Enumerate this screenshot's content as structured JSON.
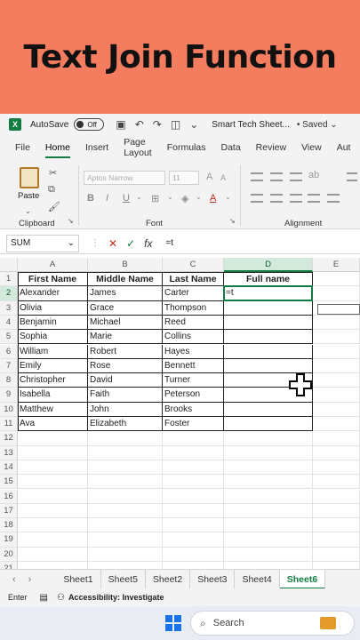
{
  "banner": {
    "title": "Text Join Function"
  },
  "titlebar": {
    "autosave_label": "AutoSave",
    "toggle_label": "Off",
    "doc_name": "Smart Tech Sheet...",
    "saved_label": "• Saved ⌄"
  },
  "menu": {
    "items": [
      "File",
      "Home",
      "Insert",
      "Page Layout",
      "Formulas",
      "Data",
      "Review",
      "View",
      "Aut"
    ]
  },
  "ribbon": {
    "paste_label": "Paste",
    "clipboard_label": "Clipboard",
    "font_label": "Font",
    "alignment_label": "Alignment",
    "font_name": "Aptos Narrow",
    "font_size": "11"
  },
  "formula_bar": {
    "name_box": "SUM",
    "formula": "=t"
  },
  "columns": [
    "A",
    "B",
    "C",
    "D",
    "E"
  ],
  "rows": [
    "1",
    "2",
    "3",
    "4",
    "5",
    "6",
    "7",
    "8",
    "9",
    "10",
    "11",
    "12",
    "13",
    "14",
    "15",
    "16",
    "17",
    "18",
    "19",
    "20",
    "21"
  ],
  "table": {
    "headers": [
      "First Name",
      "Middle Name",
      "Last Name",
      "Full name"
    ],
    "data": [
      [
        "Alexander",
        "James",
        "Carter",
        "=t"
      ],
      [
        "Olivia",
        "Grace",
        "Thompson",
        ""
      ],
      [
        "Benjamin",
        "Michael",
        "Reed",
        ""
      ],
      [
        "Sophia",
        "Marie",
        "Collins",
        ""
      ],
      [
        "William",
        "Robert",
        "Hayes",
        ""
      ],
      [
        "Emily",
        "Rose",
        "Bennett",
        ""
      ],
      [
        "Christopher",
        "David",
        "Turner",
        ""
      ],
      [
        "Isabella",
        "Faith",
        "Peterson",
        ""
      ],
      [
        "Matthew",
        "John",
        "Brooks",
        ""
      ],
      [
        "Ava",
        "Elizabeth",
        "Foster",
        ""
      ]
    ]
  },
  "sheet_tabs": [
    "Sheet1",
    "Sheet5",
    "Sheet2",
    "Sheet3",
    "Sheet4",
    "Sheet6"
  ],
  "active_tab": "Sheet6",
  "status": {
    "mode": "Enter",
    "accessibility": "Accessibility: Investigate"
  },
  "taskbar": {
    "search_placeholder": "Search"
  },
  "colors": {
    "accent": "#107c41",
    "banner": "#f47d5f"
  }
}
